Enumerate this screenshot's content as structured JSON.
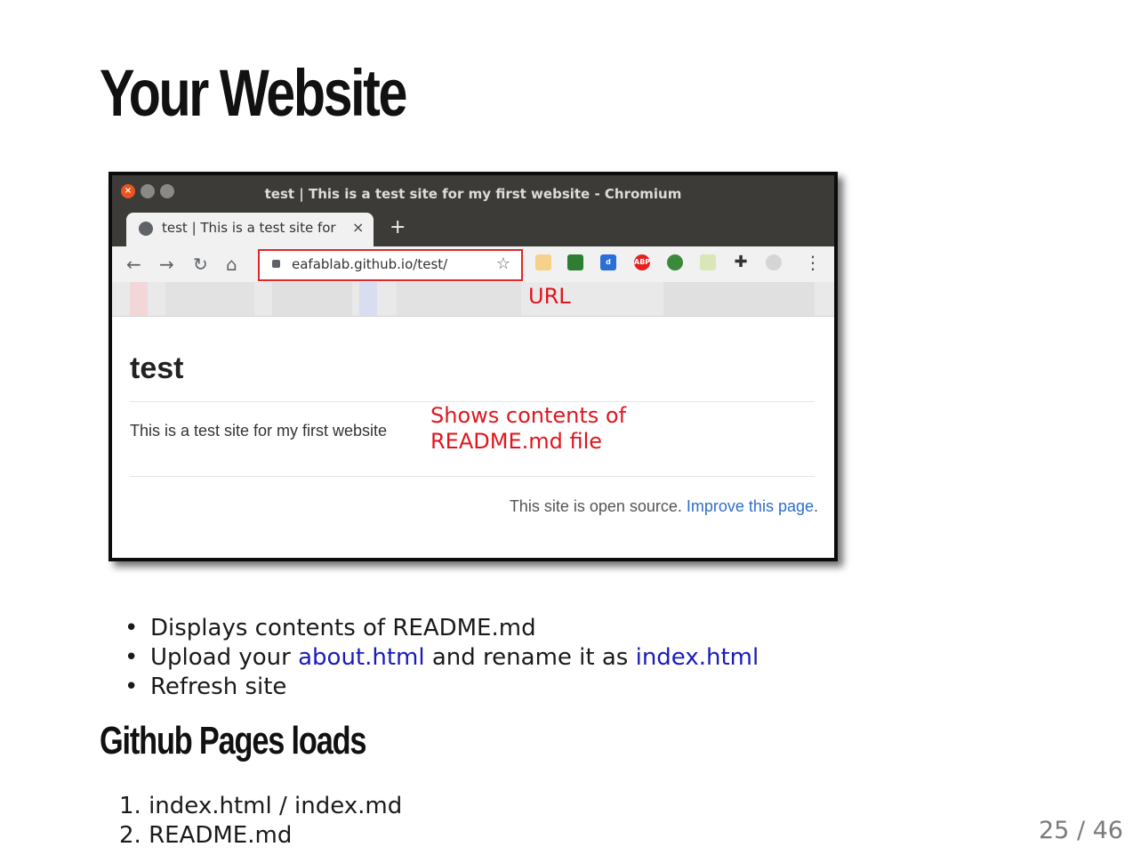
{
  "slide": {
    "title": "Your Website",
    "subtitle": "Github Pages loads",
    "bullets": [
      {
        "text": "Displays contents of README.md"
      },
      {
        "pre": "Upload your ",
        "link1": "about.html",
        "mid": " and rename it as ",
        "link2": "index.html"
      },
      {
        "text": "Refresh site"
      }
    ],
    "ordered_list": [
      {
        "num": "1.",
        "text": "index.html / index.md"
      },
      {
        "num": "2.",
        "text": "README.md"
      }
    ],
    "page_number": "25 / 46"
  },
  "browser": {
    "window_title": "test | This is a test site for my first website - Chromium",
    "tab_title": "test | This is a test site for my first website",
    "tab_close": "×",
    "new_tab": "+",
    "url": "eafablab.github.io/test/",
    "url_annotation": "URL",
    "extensions": [
      "clipboard-icon",
      "image-icon",
      "d-icon",
      "adblock-icon",
      "globe-icon",
      "notes-icon",
      "puzzle-icon",
      "profile-icon"
    ]
  },
  "webpage": {
    "heading": "test",
    "paragraph": "This is a test site for my first website",
    "annotation_line1": "Shows contents of",
    "annotation_line2": "README.md file",
    "footer_text": "This site is open source. ",
    "footer_link": "Improve this page",
    "footer_end": "."
  },
  "colors": {
    "annotation_red": "#e0161e",
    "link_blue": "#1b1bbd",
    "titlebar": "#3c3b37"
  }
}
